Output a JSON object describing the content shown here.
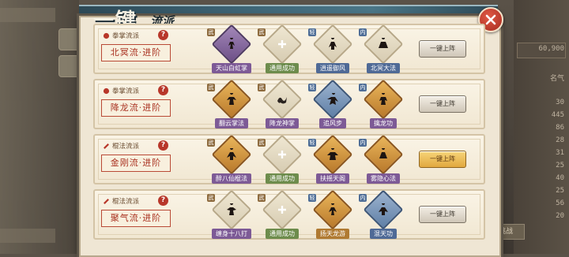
{
  "dialog": {
    "title": "一键",
    "title_sub": "流派",
    "close_icon": "close-icon"
  },
  "background": {
    "right_values": [
      "60,900",
      "名气",
      "30",
      "445",
      "86",
      "28",
      "31",
      "25",
      "40",
      "25",
      "56",
      "20"
    ],
    "bottom_button": "挑战"
  },
  "rows": [
    {
      "category": "拳掌流派",
      "name": "北冥流·进阶",
      "button": "一键上阵",
      "button_active": false,
      "skills": [
        {
          "label": "天山白虹掌",
          "gem": "purple",
          "label_color": "purple",
          "tag": "武"
        },
        {
          "label": "通用成功",
          "gem": "empty",
          "label_color": "green",
          "tag": "武"
        },
        {
          "label": "逍遥御风",
          "gem": "empty-dark",
          "label_color": "blue",
          "tag": "轻"
        },
        {
          "label": "北冥大法",
          "gem": "empty-dark",
          "label_color": "blue",
          "tag": "内"
        }
      ]
    },
    {
      "category": "拳掌流派",
      "name": "降龙流·进阶",
      "button": "一键上阵",
      "button_active": false,
      "skills": [
        {
          "label": "翻云掌法",
          "gem": "gold",
          "label_color": "purple",
          "tag": "武"
        },
        {
          "label": "降龙神掌",
          "gem": "empty-dark",
          "label_color": "purple",
          "tag": "武"
        },
        {
          "label": "追风步",
          "gem": "blue",
          "label_color": "purple",
          "tag": "轻"
        },
        {
          "label": "擒龙功",
          "gem": "gold",
          "label_color": "purple",
          "tag": "内"
        }
      ]
    },
    {
      "category": "棍法流派",
      "name": "金刚流·进阶",
      "button": "一键上阵",
      "button_active": true,
      "skills": [
        {
          "label": "醉八仙棍法",
          "gem": "gold",
          "label_color": "purple",
          "tag": "武"
        },
        {
          "label": "通用成功",
          "gem": "empty",
          "label_color": "green",
          "tag": "武"
        },
        {
          "label": "扶摇天阁",
          "gem": "gold",
          "label_color": "purple",
          "tag": "轻"
        },
        {
          "label": "雾隐心法",
          "gem": "gold",
          "label_color": "purple",
          "tag": "内"
        }
      ]
    },
    {
      "category": "棍法流派",
      "name": "聚气流·进阶",
      "button": "一键上阵",
      "button_active": false,
      "skills": [
        {
          "label": "缠身十八打",
          "gem": "empty-dark",
          "label_color": "purple",
          "tag": "武"
        },
        {
          "label": "通用成功",
          "gem": "empty",
          "label_color": "green",
          "tag": "武"
        },
        {
          "label": "扬天龙游",
          "gem": "gold",
          "label_color": "gold",
          "tag": "轻"
        },
        {
          "label": "混天功",
          "gem": "blue",
          "label_color": "blue",
          "tag": "内"
        }
      ]
    }
  ]
}
